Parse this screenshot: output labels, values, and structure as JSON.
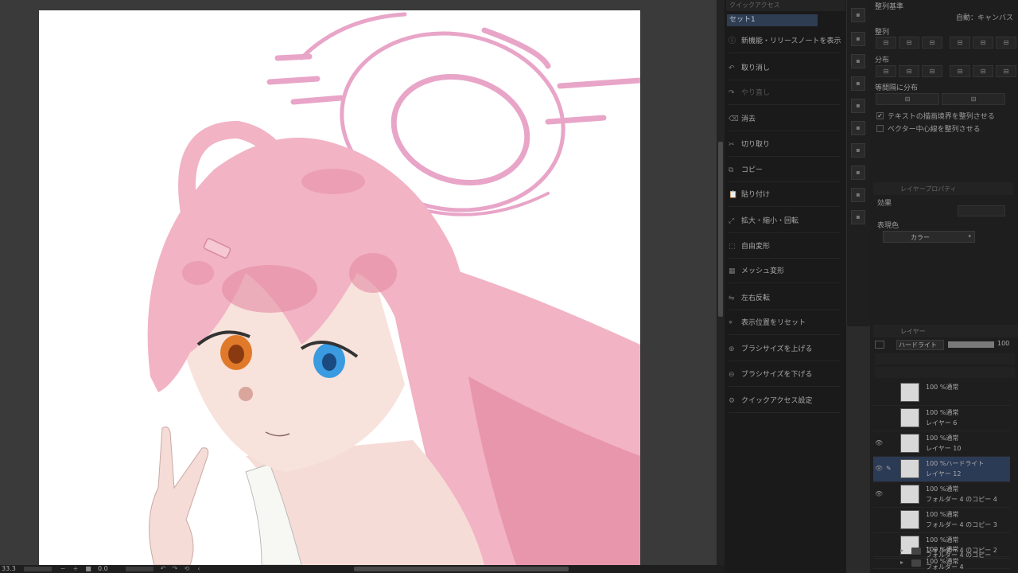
{
  "status": {
    "zoom": "33.3",
    "rotation": "0.0"
  },
  "quick_access": {
    "header": "クイックアクセス",
    "tab": "セット1",
    "items": [
      {
        "label": "新機能・リリースノートを表示",
        "icon": "info-icon",
        "enabled": true
      },
      {
        "label": "取り消し",
        "icon": "undo-icon",
        "enabled": true
      },
      {
        "label": "やり直し",
        "icon": "redo-icon",
        "enabled": false
      },
      {
        "label": "消去",
        "icon": "erase-icon",
        "enabled": true
      },
      {
        "label": "切り取り",
        "icon": "cut-icon",
        "enabled": true
      },
      {
        "label": "コピー",
        "icon": "copy-icon",
        "enabled": true
      },
      {
        "label": "貼り付け",
        "icon": "paste-icon",
        "enabled": true
      },
      {
        "label": "拡大・縮小・回転",
        "icon": "transform-icon",
        "enabled": true
      },
      {
        "label": "自由変形",
        "icon": "free-transform-icon",
        "enabled": true
      },
      {
        "label": "メッシュ変形",
        "icon": "mesh-icon",
        "enabled": true
      },
      {
        "label": "左右反転",
        "icon": "flip-icon",
        "enabled": true
      },
      {
        "label": "表示位置をリセット",
        "icon": "reset-view-icon",
        "enabled": true
      },
      {
        "label": "ブラシサイズを上げる",
        "icon": "brush-up-icon",
        "enabled": true
      },
      {
        "label": "ブラシサイズを下げる",
        "icon": "brush-down-icon",
        "enabled": true
      },
      {
        "label": "クイックアクセス設定",
        "icon": "settings-icon",
        "enabled": true
      }
    ]
  },
  "align_panel": {
    "reference_label": "整列基準",
    "reference_value": "自動：キャンバス",
    "align_label": "整列",
    "distribute_label": "分布",
    "distribute_equal_label": "等間隔に分布",
    "check_text_bounds": {
      "label": "テキストの描画境界を整列させる",
      "checked": true
    },
    "check_vector_center": {
      "label": "ベクター中心線を整列させる",
      "checked": false
    }
  },
  "layer_property": {
    "header": "レイヤープロパティ",
    "effect_label": "効果",
    "expression_color_label": "表現色",
    "expression_color_value": "カラー"
  },
  "layers": {
    "header": "レイヤー",
    "blend_mode": "ハードライト",
    "opacity": 100,
    "opacity_label": "100",
    "items": [
      {
        "line1": "100 %通常",
        "line2": "",
        "visible": false,
        "selected": false,
        "type": "layer"
      },
      {
        "line1": "100 %通常",
        "line2": "レイヤー 6",
        "visible": false,
        "selected": false,
        "type": "layer"
      },
      {
        "line1": "100 %通常",
        "line2": "レイヤー 10",
        "visible": true,
        "selected": false,
        "type": "layer"
      },
      {
        "line1": "100 %ハードライト",
        "line2": "レイヤー 12",
        "visible": true,
        "selected": true,
        "type": "layer"
      },
      {
        "line1": "100 %通常",
        "line2": "フォルダー 4 のコピー 4",
        "visible": true,
        "selected": false,
        "type": "layer"
      },
      {
        "line1": "100 %通常",
        "line2": "フォルダー 4 のコピー 3",
        "visible": false,
        "selected": false,
        "type": "layer"
      },
      {
        "line1": "100 %通常",
        "line2": "フォルダー 4 のコピー 2",
        "visible": false,
        "selected": false,
        "type": "layer"
      },
      {
        "line1": "100 %通常",
        "line2": "フォルダー 4 のコピー",
        "visible": false,
        "selected": false,
        "type": "folder"
      },
      {
        "line1": "100 %通常",
        "line2": "フォルダー 4",
        "visible": false,
        "selected": false,
        "type": "folder"
      }
    ]
  },
  "colors": {
    "hair": "#f2b3c4",
    "hair_shadow": "#e48aa3",
    "skin": "#f6dcd6",
    "halo": "#e8a5c8",
    "eye_blue": "#3a9be0",
    "eye_orange": "#e07a2a",
    "selection": "#2b3a55"
  }
}
